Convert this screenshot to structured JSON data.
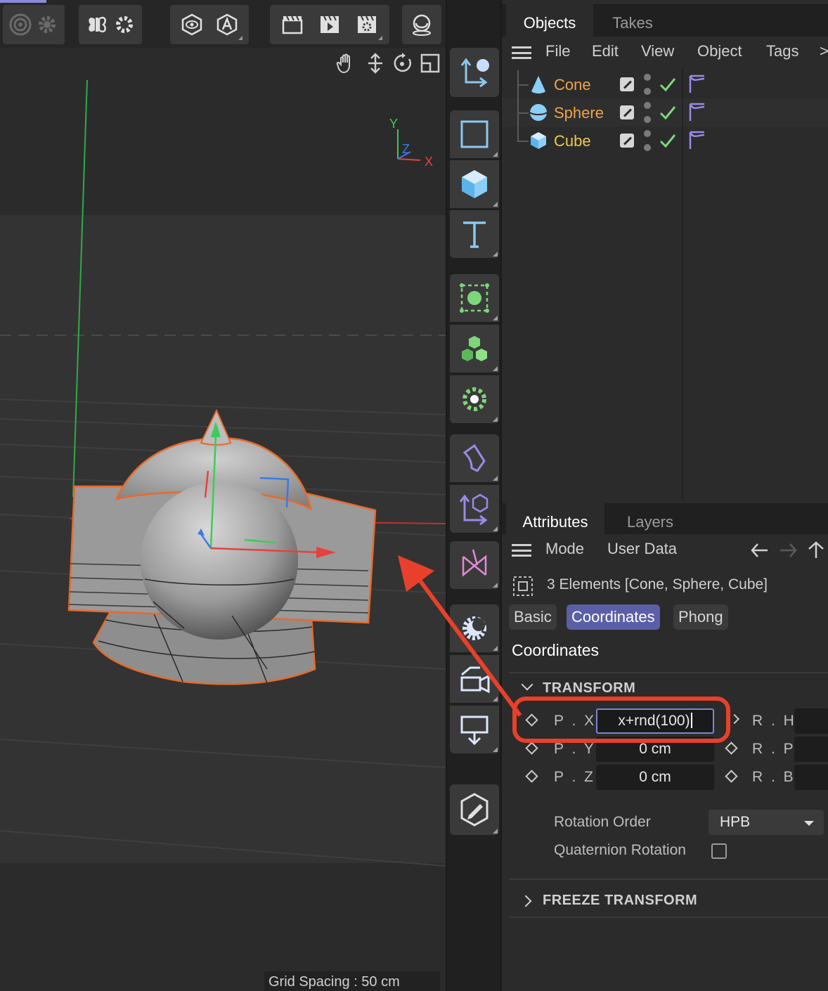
{
  "object_manager": {
    "tabs": [
      "Objects",
      "Takes"
    ],
    "menu": [
      "File",
      "Edit",
      "View",
      "Object",
      "Tags"
    ],
    "more_glyph": ">",
    "objects": [
      {
        "name": "Cone",
        "color": "#f0a44a"
      },
      {
        "name": "Sphere",
        "color": "#f0a44a"
      },
      {
        "name": "Cube",
        "color": "#f0c94a"
      }
    ]
  },
  "attribute_manager": {
    "tabs": [
      "Attributes",
      "Layers"
    ],
    "menu": [
      "Mode",
      "User Data"
    ],
    "selection_label": "3 Elements [Cone, Sphere, Cube]",
    "section_tabs": [
      "Basic",
      "Coordinates",
      "Phong"
    ],
    "active_tab": "Coordinates",
    "section_title": "Coordinates",
    "transform_header": "TRANSFORM",
    "fields": {
      "px_label": "P . X",
      "px_value": "x+rnd(100)",
      "py_label": "P . Y",
      "py_value": "0 cm",
      "pz_label": "P . Z",
      "pz_value": "0 cm",
      "rh_label": "R . H",
      "rp_label": "R . P",
      "rb_label": "R . B"
    },
    "rotation_order_label": "Rotation Order",
    "rotation_order_value": "HPB",
    "quaternion_label": "Quaternion Rotation",
    "quaternion_checked": false,
    "freeze_header": "FREEZE TRANSFORM"
  },
  "viewport": {
    "grid_spacing": "Grid Spacing : 50 cm",
    "axis_labels": {
      "y": "Y",
      "z": "Z",
      "x": "X"
    }
  },
  "colors": {
    "accent": "#5b5fa8",
    "annotation": "#e8402a",
    "selection_outline": "#e86a2a",
    "x_axis": "#e84040",
    "y_axis": "#3ccc5a",
    "z_axis": "#3a7ae8"
  }
}
